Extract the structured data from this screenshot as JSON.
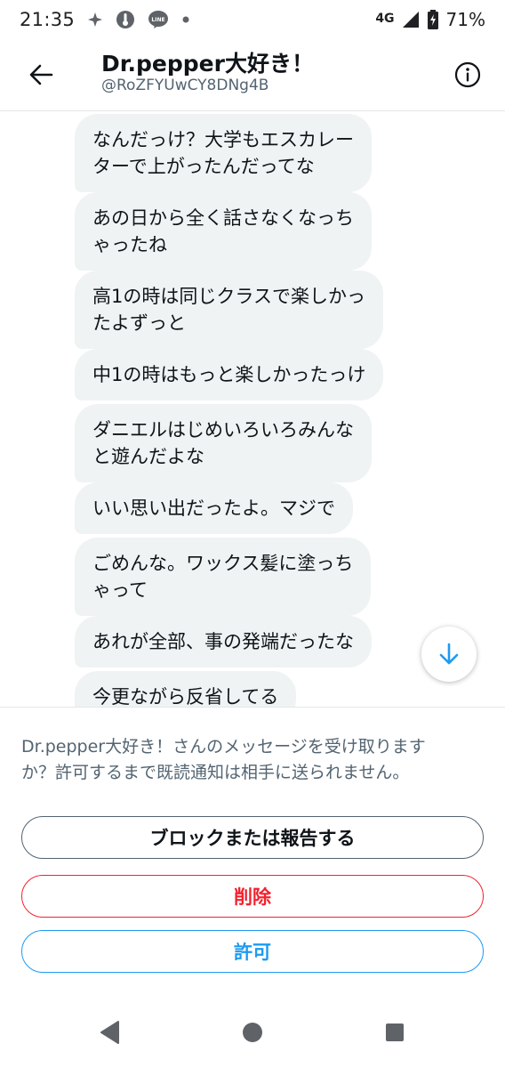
{
  "status_bar": {
    "time": "21:35",
    "network": "4G",
    "battery": "71%",
    "icons": [
      "pinwheel-icon",
      "thermometer-icon",
      "line-app-icon",
      "dot-icon",
      "signal-icon",
      "battery-icon"
    ]
  },
  "header": {
    "title": "Dr.pepper大好き！",
    "handle": "@RoZFYUwCY8DNg4B",
    "back_icon": "arrow-left-icon",
    "info_icon": "info-icon"
  },
  "messages": [
    {
      "lines": [
        "なんだっけ？大学もエスカレー",
        "ターで上がったんだってな"
      ]
    },
    {
      "lines": [
        "あの日から全く話さなくなっち",
        "ゃったね"
      ]
    },
    {
      "lines": [
        "高1の時は同じクラスで楽しかっ",
        "たよずっと"
      ]
    },
    {
      "lines": [
        "中1の時はもっと楽しかったっけ"
      ]
    },
    {
      "lines": [
        "ダニエルはじめいろいろみんな",
        "と遊んだよな"
      ]
    },
    {
      "lines": [
        "いい思い出だったよ。マジで"
      ]
    },
    {
      "lines": [
        "ごめんな。ワックス髪に塗っち",
        "ゃって"
      ]
    },
    {
      "lines": [
        "あれが全部、事の発端だったな"
      ]
    },
    {
      "lines": [
        "今更ながら反省してる"
      ]
    }
  ],
  "request": {
    "prompt_line1": "Dr.pepper大好き！さんのメッセージを受け取ります",
    "prompt_line2": "か？許可するまで既読通知は相手に送られません。",
    "block_label": "ブロックまたは報告する",
    "delete_label": "削除",
    "allow_label": "許可"
  },
  "colors": {
    "bubble_bg": "#eff3f4",
    "accent_blue": "#1d9bf0",
    "danger_red": "#f4212e",
    "muted_text": "#536471"
  },
  "nav": {
    "icons": [
      "back-triangle-icon",
      "home-circle-icon",
      "recents-square-icon"
    ]
  }
}
